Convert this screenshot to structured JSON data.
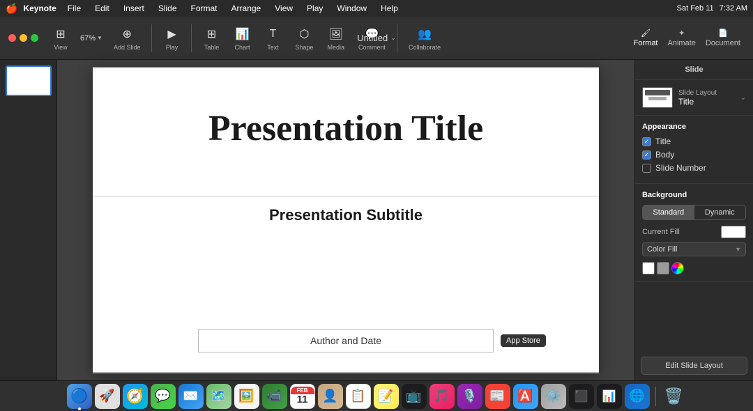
{
  "menubar": {
    "apple": "🍎",
    "appName": "Keynote",
    "items": [
      "File",
      "Edit",
      "Insert",
      "Slide",
      "Format",
      "Arrange",
      "View",
      "Play",
      "Window",
      "Help"
    ],
    "rightItems": [
      "Sat Feb 11",
      "7:32 AM"
    ],
    "time": "7:32 AM",
    "date": "Sat Feb 11"
  },
  "toolbar": {
    "viewLabel": "View",
    "zoomValue": "67%",
    "addSlideLabel": "Add Slide",
    "playLabel": "Play",
    "tableLabel": "Table",
    "chartLabel": "Chart",
    "textLabel": "Text",
    "shapeLabel": "Shape",
    "mediaLabel": "Media",
    "commentLabel": "Comment",
    "collaborateLabel": "Collaborate",
    "formatLabel": "Format",
    "animateLabel": "Animate",
    "documentLabel": "Document",
    "title": "Untitled",
    "titleChevron": "⌄"
  },
  "slide": {
    "title": "Presentation Title",
    "subtitle": "Presentation Subtitle",
    "authorFooter": "Author and Date"
  },
  "rightPanel": {
    "tabs": [
      "Format",
      "Animate",
      "Document"
    ],
    "activeTab": "Format",
    "sectionTitle": "Slide",
    "slideLayout": {
      "label": "Slide Layout",
      "value": "Title",
      "chevron": "⌄"
    },
    "appearance": {
      "title": "Appearance",
      "items": [
        {
          "label": "Title",
          "checked": true
        },
        {
          "label": "Body",
          "checked": true
        },
        {
          "label": "Slide Number",
          "checked": false
        }
      ]
    },
    "background": {
      "title": "Background",
      "buttons": [
        "Standard",
        "Dynamic"
      ],
      "activeButton": "Standard"
    },
    "currentFill": {
      "label": "Current Fill",
      "fillColor": "#ffffff"
    },
    "colorFill": {
      "label": "Color Fill"
    },
    "editLayoutButton": "Edit Slide Layout"
  },
  "appStoreTooltip": "App Store",
  "dock": {
    "icons": [
      {
        "name": "finder",
        "emoji": "🔵",
        "bg": "#3a8af9",
        "label": "Finder"
      },
      {
        "name": "launchpad",
        "emoji": "🚀",
        "bg": "#f0f0f0",
        "label": "Launchpad"
      },
      {
        "name": "safari",
        "emoji": "🧭",
        "bg": "#006cff",
        "label": "Safari"
      },
      {
        "name": "messages",
        "emoji": "💬",
        "bg": "#5bd65a",
        "label": "Messages"
      },
      {
        "name": "mail",
        "emoji": "✉️",
        "bg": "#4a9eff",
        "label": "Mail"
      },
      {
        "name": "maps",
        "emoji": "🗺️",
        "bg": "#4caf50",
        "label": "Maps"
      },
      {
        "name": "photos",
        "emoji": "🖼️",
        "bg": "#ffaa00",
        "label": "Photos"
      },
      {
        "name": "facetime",
        "emoji": "📹",
        "bg": "#3dcc4a",
        "label": "FaceTime"
      },
      {
        "name": "calendar",
        "emoji": "📅",
        "bg": "#ff3b30",
        "label": "Calendar"
      },
      {
        "name": "contacts",
        "emoji": "👤",
        "bg": "#c8a882",
        "label": "Contacts"
      },
      {
        "name": "reminders",
        "emoji": "📋",
        "bg": "#ffffff",
        "label": "Reminders"
      },
      {
        "name": "notes",
        "emoji": "📝",
        "bg": "#ffec6e",
        "label": "Notes"
      },
      {
        "name": "appletv",
        "emoji": "📺",
        "bg": "#1c1c1c",
        "label": "Apple TV"
      },
      {
        "name": "music",
        "emoji": "🎵",
        "bg": "#fc3c44",
        "label": "Music"
      },
      {
        "name": "podcasts",
        "emoji": "🎙️",
        "bg": "#9b59b6",
        "label": "Podcasts"
      },
      {
        "name": "news",
        "emoji": "📰",
        "bg": "#ff3b30",
        "label": "News"
      },
      {
        "name": "appstore",
        "emoji": "🅰️",
        "bg": "#3a8af9",
        "label": "App Store"
      },
      {
        "name": "settings",
        "emoji": "⚙️",
        "bg": "#8e8e93",
        "label": "System Preferences"
      },
      {
        "name": "terminal",
        "emoji": "⬛",
        "bg": "#1c1c1c",
        "label": "Terminal"
      },
      {
        "name": "monitor",
        "emoji": "📊",
        "bg": "#1c1c1c",
        "label": "Activity Monitor"
      },
      {
        "name": "endpoint",
        "emoji": "🌐",
        "bg": "#3a8af9",
        "label": "Remote Desktop"
      },
      {
        "name": "trash",
        "emoji": "🗑️",
        "bg": "#8e8e8e",
        "label": "Trash"
      }
    ]
  }
}
